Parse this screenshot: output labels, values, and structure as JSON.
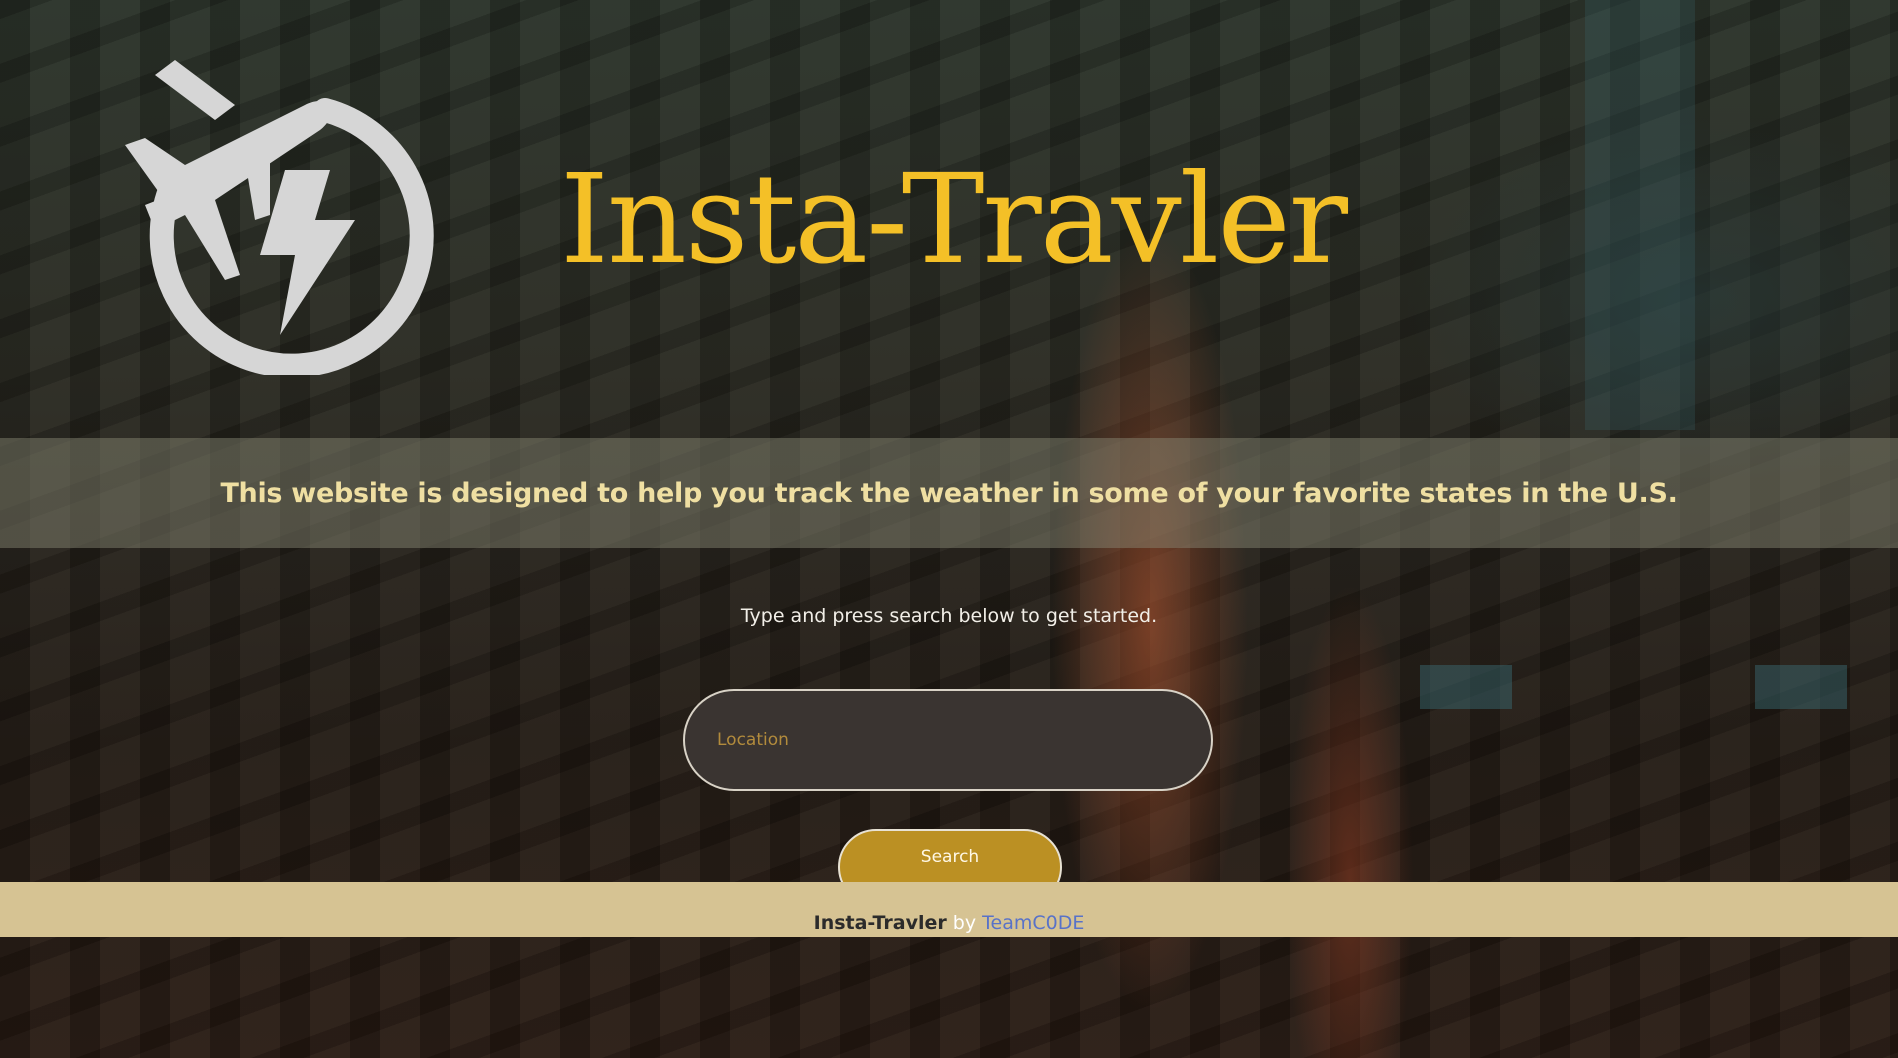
{
  "header": {
    "title": "Insta-Travler",
    "logo_icon": "plane-lightning-icon"
  },
  "banner": {
    "text": "This website is designed to help you track the weather in some of your favorite states in the U.S."
  },
  "search": {
    "instructions": "Type and press search below to get started.",
    "placeholder": "Location",
    "button_label": "Search"
  },
  "footer": {
    "brand": "Insta-Travler",
    "by": "by",
    "team_link": "TeamC0DE"
  },
  "colors": {
    "title": "#f4c027",
    "banner_text": "#efdfa2",
    "button": "#bb9023",
    "footer_bg": "#d6c393",
    "link": "#5872c8"
  }
}
